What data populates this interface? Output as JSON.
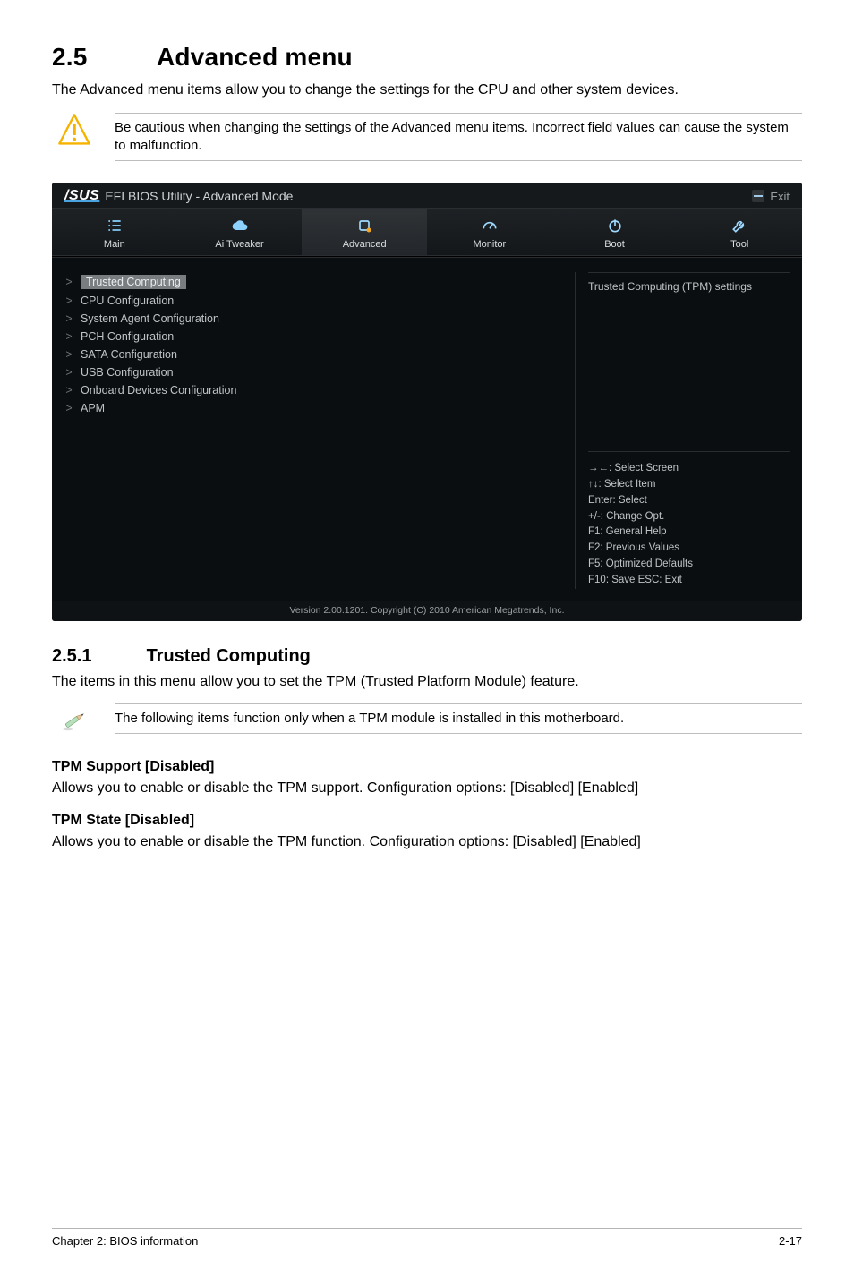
{
  "section": {
    "number": "2.5",
    "title": "Advanced menu"
  },
  "intro": "The Advanced menu items allow you to change the settings for the CPU and other system devices.",
  "warning": "Be cautious when changing the settings of the Advanced menu items. Incorrect field values can cause the system to malfunction.",
  "bios": {
    "brand": "/SUS",
    "title": "EFI BIOS Utility - Advanced Mode",
    "exit": "Exit",
    "tabs": [
      "Main",
      "Ai Tweaker",
      "Advanced",
      "Monitor",
      "Boot",
      "Tool"
    ],
    "active_tab_index": 2,
    "menu_items": [
      "Trusted Computing",
      "CPU Configuration",
      "System Agent Configuration",
      "PCH Configuration",
      "SATA Configuration",
      "USB Configuration",
      "Onboard Devices Configuration",
      "APM"
    ],
    "selected_menu_index": 0,
    "right_top": "Trusted Computing (TPM) settings",
    "help": [
      "→←: Select Screen",
      "↑↓: Select Item",
      "Enter: Select",
      "+/-: Change Opt.",
      "F1: General Help",
      "F2: Previous Values",
      "F5: Optimized Defaults",
      "F10: Save   ESC: Exit"
    ],
    "footer": "Version 2.00.1201. Copyright (C) 2010 American Megatrends, Inc."
  },
  "subsection": {
    "number": "2.5.1",
    "title": "Trusted Computing"
  },
  "sub_intro": "The items in this menu allow you to set the TPM (Trusted Platform Module) feature.",
  "note": "The following items function only when a TPM module is installed in this motherboard.",
  "tpm_support_heading": "TPM Support [Disabled]",
  "tpm_support_body": "Allows you to enable or disable the TPM support. Configuration options: [Disabled] [Enabled]",
  "tpm_state_heading": "TPM State [Disabled]",
  "tpm_state_body": "Allows you to enable or disable the TPM function. Configuration options: [Disabled] [Enabled]",
  "footer": {
    "left": "Chapter 2: BIOS information",
    "right": "2-17"
  }
}
